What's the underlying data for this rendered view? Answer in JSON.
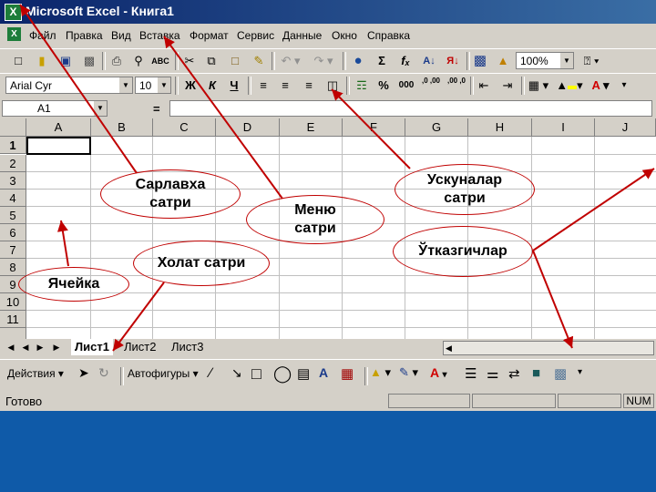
{
  "window": {
    "title": "Microsoft Excel - Книга1",
    "app_icon": "excel-icon"
  },
  "menu": [
    {
      "label": "Файл"
    },
    {
      "label": "Правка"
    },
    {
      "label": "Вид"
    },
    {
      "label": "Вставка"
    },
    {
      "label": "Формат"
    },
    {
      "label": "Сервис"
    },
    {
      "label": "Данные"
    },
    {
      "label": "Окно"
    },
    {
      "label": "Справка"
    }
  ],
  "standard_toolbar": {
    "zoom": "100%",
    "icons": [
      "new-icon",
      "open-icon",
      "save-icon",
      "permission-icon",
      "print-icon",
      "print-preview-icon",
      "spelling-icon",
      "cut-icon",
      "copy-icon",
      "paste-icon",
      "format-painter-icon",
      "undo-icon",
      "redo-icon",
      "hyperlink-icon",
      "autosum-icon",
      "function-icon",
      "sort-ascending-icon",
      "sort-descending-icon",
      "chart-wizard-icon",
      "drawing-icon",
      "help-icon"
    ]
  },
  "formatting_toolbar": {
    "font_name": "Arial Cyr",
    "font_size": "10",
    "bold": "Ж",
    "italic": "К",
    "underline": "Ч",
    "percent": "%",
    "thousands": "000",
    "increase_decimal": ",0 ,00",
    "decrease_decimal": ",00 ,0",
    "accent": "#d00000",
    "fill_color": "#ffff00"
  },
  "formula_bar": {
    "name_box": "A1",
    "equals": "=",
    "formula": ""
  },
  "grid": {
    "columns": [
      "A",
      "B",
      "C",
      "D",
      "E",
      "F",
      "G",
      "H",
      "I",
      "J"
    ],
    "rows": [
      "1",
      "2",
      "3",
      "4",
      "5",
      "6",
      "7",
      "8",
      "9",
      "10",
      "11"
    ],
    "active_cell": "A1"
  },
  "sheet_tabs": [
    {
      "label": "Лист1",
      "active": true
    },
    {
      "label": "Лист2",
      "active": false
    },
    {
      "label": "Лист3",
      "active": false
    }
  ],
  "drawing_toolbar": {
    "actions": "Действия",
    "autoshapes": "Автофигуры"
  },
  "status_bar": {
    "status": "Готово",
    "num": "NUM"
  },
  "callouts": {
    "title_bar": "Сарлавха\nсатри",
    "menu_bar": "Меню\nсатри",
    "toolbars": "Ускуналар\nсатри",
    "switches": "Ўтказгичлар",
    "status_bar": "Холат сатри",
    "cell": "Ячейка"
  }
}
